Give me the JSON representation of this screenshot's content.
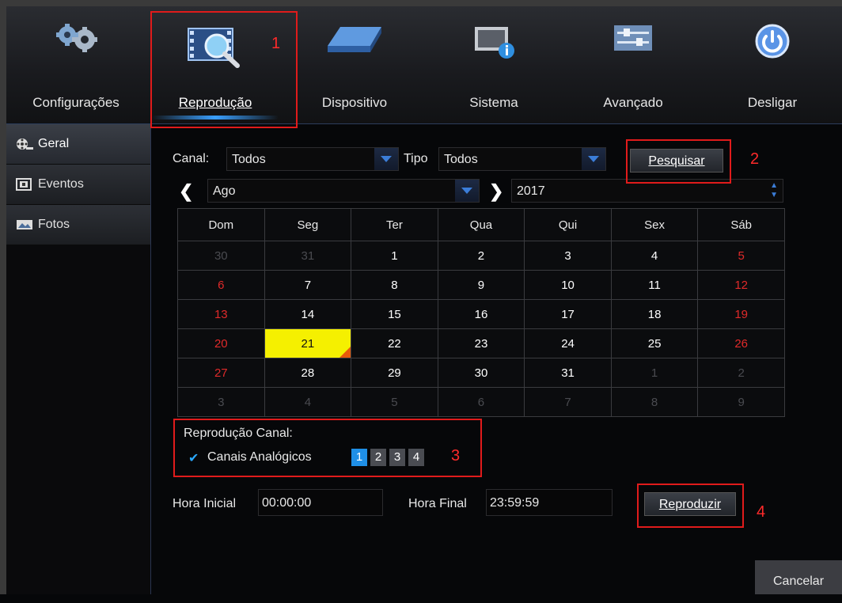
{
  "nav": [
    {
      "label": "Configurações",
      "icon": "gears-icon"
    },
    {
      "label": "Reprodução",
      "icon": "playback-film-icon"
    },
    {
      "label": "Dispositivo",
      "icon": "hard-drive-icon"
    },
    {
      "label": "Sistema",
      "icon": "system-info-icon"
    },
    {
      "label": "Avançado",
      "icon": "advanced-sliders-icon"
    },
    {
      "label": "Desligar",
      "icon": "power-icon"
    }
  ],
  "sidebar": [
    {
      "label": "Geral",
      "icon": "film-reel-icon"
    },
    {
      "label": "Eventos",
      "icon": "events-icon"
    },
    {
      "label": "Fotos",
      "icon": "photos-icon"
    }
  ],
  "filters": {
    "canal_label": "Canal:",
    "canal_value": "Todos",
    "tipo_label": "Tipo",
    "tipo_value": "Todos",
    "search_button": "Pesquisar"
  },
  "month_nav": {
    "prev": "❮",
    "month": "Ago",
    "next": "❯",
    "year": "2017"
  },
  "calendar": {
    "weekdays": [
      "Dom",
      "Seg",
      "Ter",
      "Qua",
      "Qui",
      "Sex",
      "Sáb"
    ],
    "weeks": [
      [
        "30",
        "31",
        "1",
        "2",
        "3",
        "4",
        "5"
      ],
      [
        "6",
        "7",
        "8",
        "9",
        "10",
        "11",
        "12"
      ],
      [
        "13",
        "14",
        "15",
        "16",
        "17",
        "18",
        "19"
      ],
      [
        "20",
        "21",
        "22",
        "23",
        "24",
        "25",
        "26"
      ],
      [
        "27",
        "28",
        "29",
        "30",
        "31",
        "1",
        "2"
      ],
      [
        "3",
        "4",
        "5",
        "6",
        "7",
        "8",
        "9"
      ]
    ],
    "selected": "21"
  },
  "channels": {
    "title": "Reprodução Canal:",
    "checkbox_label": "Canais Analógicos",
    "check_glyph": "✔",
    "numbers": [
      "1",
      "2",
      "3",
      "4"
    ]
  },
  "time": {
    "start_label": "Hora Inicial",
    "start_value": "00:00:00",
    "end_label": "Hora Final",
    "end_value": "23:59:59",
    "play_button": "Reproduzir"
  },
  "cancel_button": "Cancelar",
  "annotations": [
    "1",
    "2",
    "3",
    "4"
  ],
  "colors": {
    "accent": "#1f8fe6",
    "highlight": "#f5f000",
    "annotation": "#e01b1b"
  }
}
